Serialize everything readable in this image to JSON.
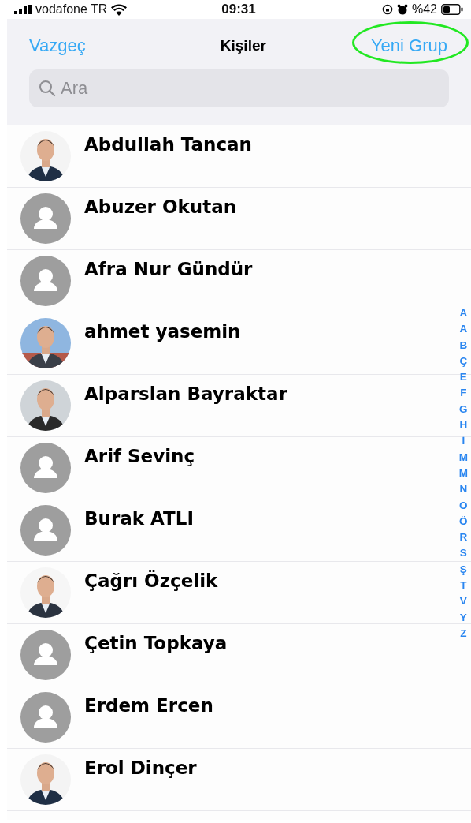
{
  "status_bar": {
    "carrier": "vodafone TR",
    "time": "09:31",
    "battery": "%42"
  },
  "nav": {
    "cancel": "Vazgeç",
    "title": "Kişiler",
    "action": {
      "label": "Yeni Grup",
      "highlighted": true
    }
  },
  "search": {
    "placeholder": "Ara"
  },
  "contacts": [
    {
      "name": "Abdullah Tancan",
      "kind": "picture"
    },
    {
      "name": "Abuzer Okutan",
      "kind": "placeholder"
    },
    {
      "name": "Afra Nur Gündür",
      "kind": "placeholder"
    },
    {
      "name": "ahmet yasemin",
      "kind": "picture"
    },
    {
      "name": "Alparslan Bayraktar",
      "kind": "picture"
    },
    {
      "name": "Arif Sevinç",
      "kind": "placeholder"
    },
    {
      "name": "Burak ATLI",
      "kind": "placeholder"
    },
    {
      "name": "Çağrı Özçelik",
      "kind": "picture"
    },
    {
      "name": "Çetin Topkaya",
      "kind": "placeholder"
    },
    {
      "name": "Erdem Ercen",
      "kind": "placeholder"
    },
    {
      "name": "Erol Dinçer",
      "kind": "picture"
    }
  ],
  "index_letters": [
    "A",
    "A",
    "B",
    "Ç",
    "E",
    "F",
    "G",
    "H",
    "İ",
    "M",
    "M",
    "N",
    "O",
    "Ö",
    "R",
    "S",
    "Ş",
    "T",
    "V",
    "Y",
    "Z"
  ]
}
